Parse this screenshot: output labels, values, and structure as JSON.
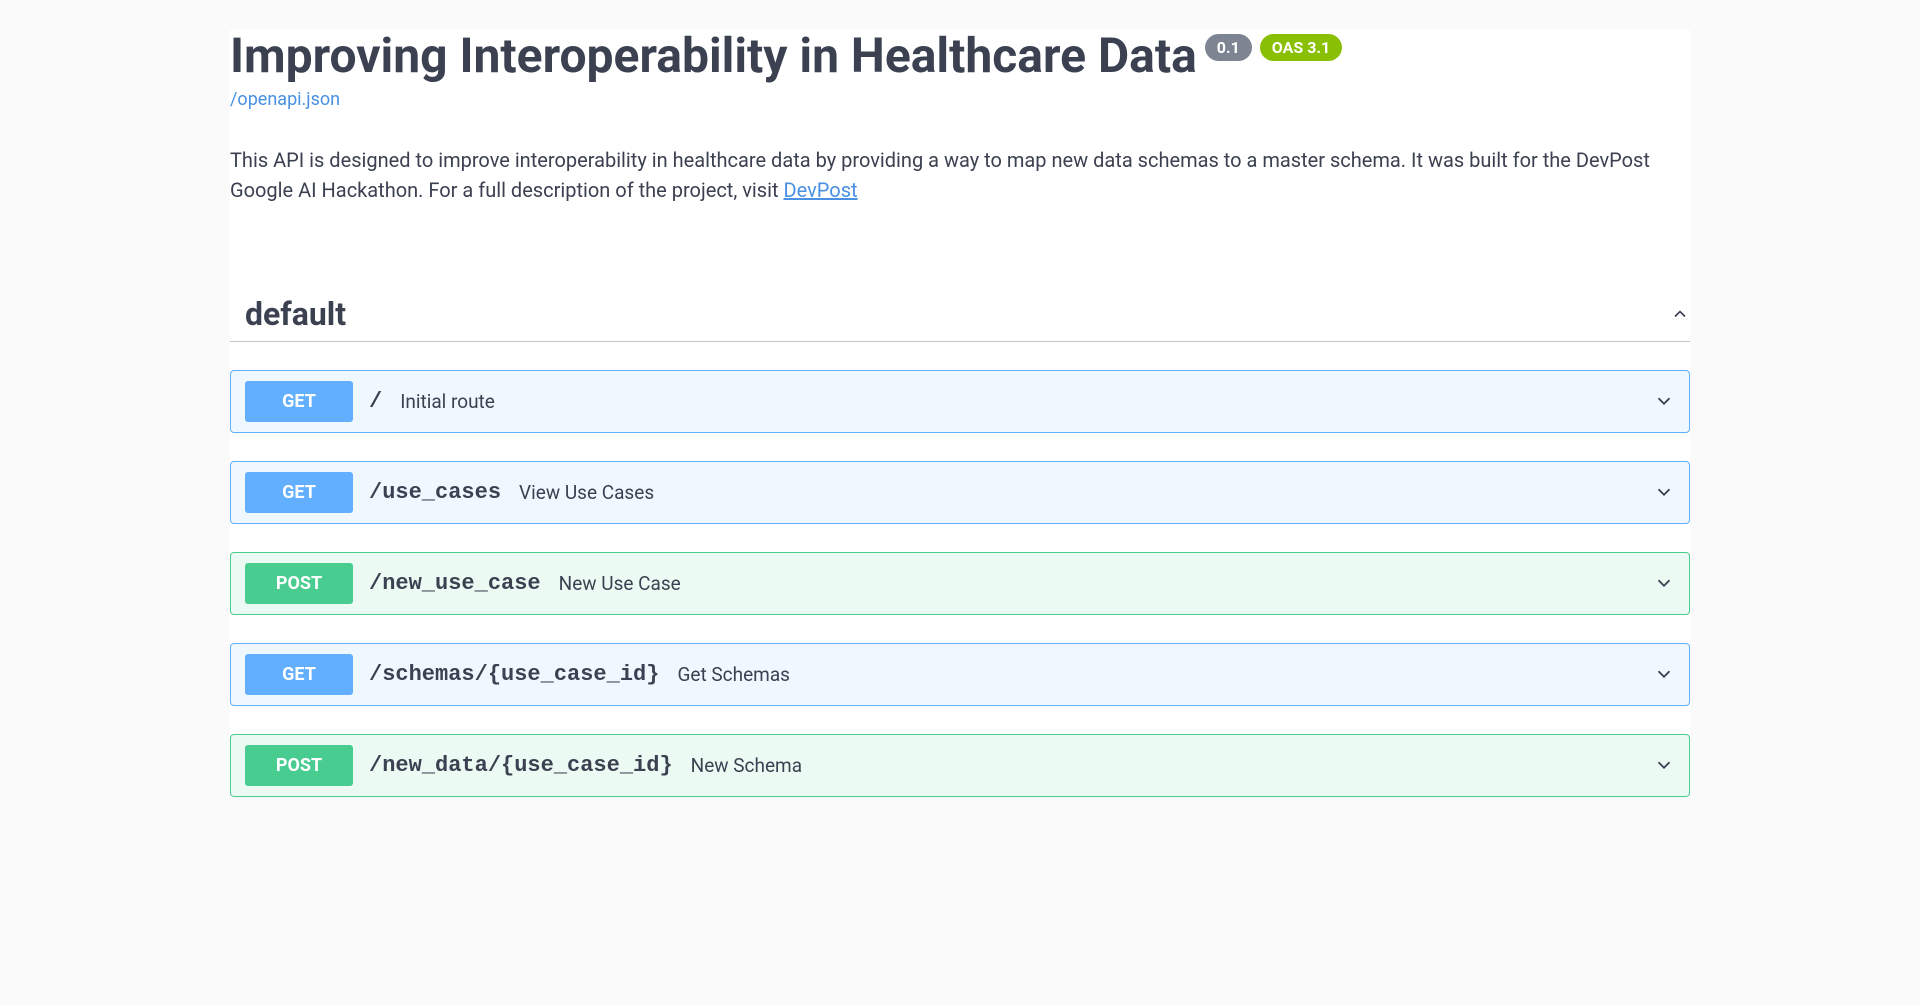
{
  "header": {
    "title": "Improving Interoperability in Healthcare Data",
    "version": "0.1",
    "oas_version": "OAS 3.1",
    "spec_link": "/openapi.json",
    "description_prefix": "This API is designed to improve interoperability in healthcare data by providing a way to map new data schemas to a master schema. It was built for the DevPost Google AI Hackathon. For a full description of the project, visit ",
    "description_link_text": "DevPost"
  },
  "tag": {
    "name": "default"
  },
  "operations": [
    {
      "method": "GET",
      "path": "/",
      "summary": "Initial route"
    },
    {
      "method": "GET",
      "path": "/use_cases",
      "summary": "View Use Cases"
    },
    {
      "method": "POST",
      "path": "/new_use_case",
      "summary": "New Use Case"
    },
    {
      "method": "GET",
      "path": "/schemas/{use_case_id}",
      "summary": "Get Schemas"
    },
    {
      "method": "POST",
      "path": "/new_data/{use_case_id}",
      "summary": "New Schema"
    }
  ]
}
